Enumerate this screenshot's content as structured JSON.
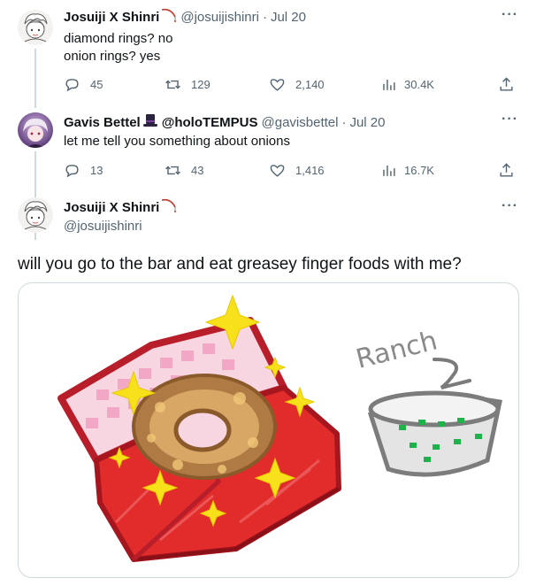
{
  "tweets": [
    {
      "name": "Josuiji X Shinri",
      "handle": "@josuijishinri",
      "dot": "·",
      "time": "Jul 20",
      "text": "diamond rings? no\nonion rings? yes",
      "replies": "45",
      "retweets": "129",
      "likes": "2,140",
      "views": "30.4K"
    },
    {
      "name": "Gavis Bettel",
      "name_suffix": "@holoTEMPUS",
      "handle": "@gavisbettel",
      "dot": "·",
      "time": "Jul 20",
      "text": "let me tell you something about onions",
      "replies": "13",
      "retweets": "43",
      "likes": "1,416",
      "views": "16.7K"
    }
  ],
  "main_tweet": {
    "name": "Josuiji X Shinri",
    "handle": "@josuijishinri",
    "text": "will you go to the bar and eat greasey finger foods with me?",
    "image_text": "Ranch"
  },
  "more_label": "···",
  "colors": {
    "text_primary": "#0f1419",
    "text_secondary": "#536471",
    "border": "#cfd9de"
  },
  "icons": [
    "reply-icon",
    "retweet-icon",
    "like-icon",
    "views-icon",
    "share-icon",
    "more-icon",
    "fishing-rod-icon",
    "top-hat-icon"
  ]
}
